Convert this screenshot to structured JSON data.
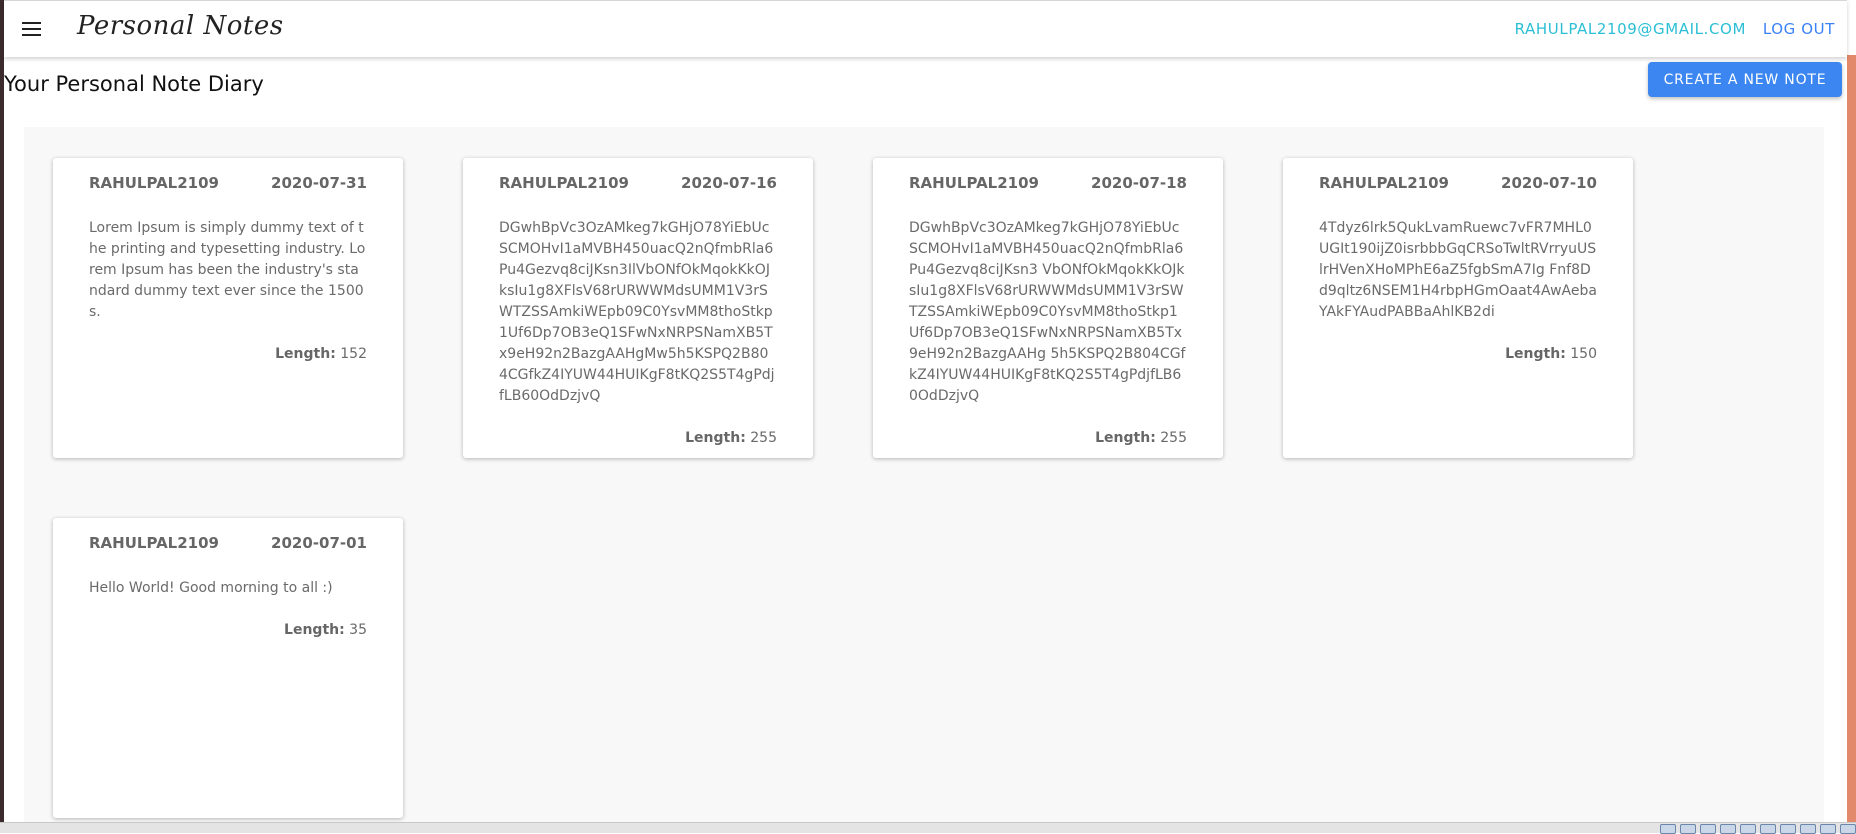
{
  "header": {
    "brand": "Personal Notes",
    "user_email": "RAHULPAL2109@GMAIL.COM",
    "logout_label": "LOG OUT"
  },
  "page": {
    "title": "Your Personal Note Diary",
    "create_label": "CREATE A NEW NOTE",
    "length_label": "Length:"
  },
  "notes": [
    {
      "user": "RAHULPAL2109",
      "date": "2020-07-31",
      "text": "Lorem Ipsum is simply dummy text of the printing and typesetting industry. Lorem Ipsum has been the industry's standard dummy text ever since the 1500s.",
      "length": "152"
    },
    {
      "user": "RAHULPAL2109",
      "date": "2020-07-16",
      "text": "DGwhBpVc3OzAMkeg7kGHjO78YiEbUcSCMOHvI1aMVBH450uacQ2nQfmbRla6Pu4Gezvq8ciJKsn3IlVbONfOkMqokKkOJksIu1g8XFlsV68rURWWMdsUMM1V3rSWTZSSAmkiWEpb09C0YsvMM8thoStkp1Uf6Dp7OB3eQ1SFwNxNRPSNamXB5Tx9eH92n2BazgAAHgMw5h5KSPQ2B804CGfkZ4IYUW44HUIKgF8tKQ2S5T4gPdjfLB60OdDzjvQ",
      "length": "255"
    },
    {
      "user": "RAHULPAL2109",
      "date": "2020-07-18",
      "text": "DGwhBpVc3OzAMkeg7kGHjO78YiEbUcSCMOHvI1aMVBH450uacQ2nQfmbRla6Pu4Gezvq8ciJKsn3 VbONfOkMqokKkOJksIu1g8XFlsV68rURWWMdsUMM1V3rSWTZSSAmkiWEpb09C0YsvMM8thoStkp1Uf6Dp7OB3eQ1SFwNxNRPSNamXB5Tx9eH92n2BazgAAHg 5h5KSPQ2B804CGfkZ4IYUW44HUIKgF8tKQ2S5T4gPdjfLB60OdDzjvQ",
      "length": "255"
    },
    {
      "user": "RAHULPAL2109",
      "date": "2020-07-10",
      "text": "4Tdyz6lrk5QukLvamRuewc7vFR7MHL0UGIt190ijZ0isrbbbGqCRSoTwltRVrryuUSlrHVenXHoMPhE6aZ5fgbSmA7Ig Fnf8Dd9qltz6NSEM1H4rbpHGmOaat4AwAebaYAkFYAudPABBaAhlKB2di",
      "length": "150"
    },
    {
      "user": "RAHULPAL2109",
      "date": "2020-07-01",
      "text": "Hello World! Good morning to all :)",
      "length": "35"
    }
  ]
}
